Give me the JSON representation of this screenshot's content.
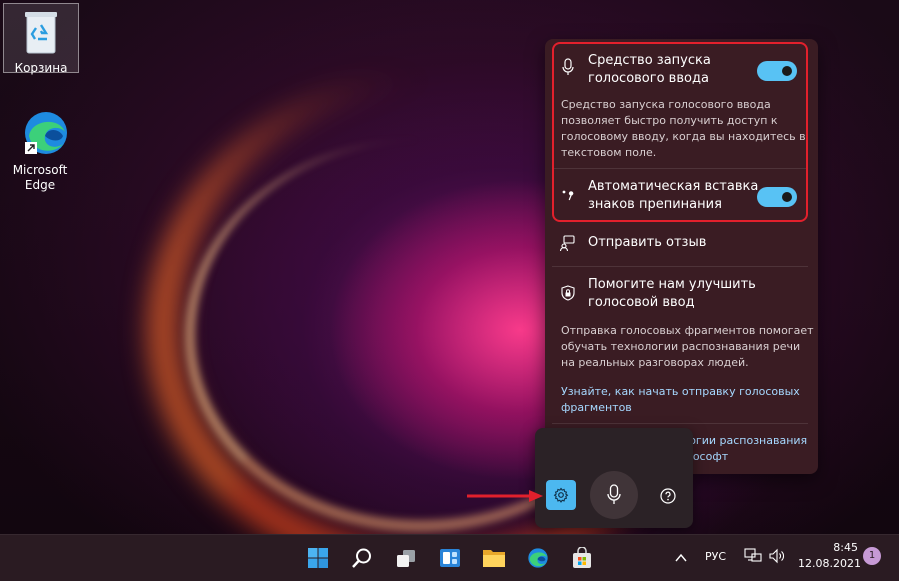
{
  "desktop": {
    "recycle_bin_label": "Корзина",
    "edge_label_line1": "Microsoft",
    "edge_label_line2": "Edge"
  },
  "flyout": {
    "launcher_title_line1": "Средство запуска",
    "launcher_title_line2": "голосового ввода",
    "launcher_toggle_on": true,
    "launcher_desc_line1": "Средство запуска голосового ввода",
    "launcher_desc_line2": "позволяет быстро получить доступ к",
    "launcher_desc_line3": "голосовому вводу, когда вы находитесь в",
    "launcher_desc_line4": "текстовом поле.",
    "punctuation_title_line1": "Автоматическая вставка",
    "punctuation_title_line2": "знаков препинания",
    "punctuation_toggle_on": true,
    "feedback_label": "Отправить отзыв",
    "improve_title_line1": "Помогите нам улучшить",
    "improve_title_line2": "голосовой ввод",
    "improve_desc_line1": "Отправка голосовых фрагментов помогает",
    "improve_desc_line2": "обучать технологии распознавания речи",
    "improve_desc_line3": "на реальных разговорах людей.",
    "learn_link_line1": "Узнайте, как начать отправку голосовых",
    "learn_link_line2": "фрагментов",
    "platform_link_line1": "На платформе технологии распознавания",
    "platform_link_line2": "речи по сети от Майкрософт"
  },
  "voicebar": {
    "settings_icon": "gear-icon",
    "mic_icon": "microphone-icon",
    "help_icon": "question-icon"
  },
  "taskbar": {
    "language": "РУС",
    "time": "8:45",
    "date": "12.08.2021",
    "notification_count": "1"
  },
  "colors": {
    "accent": "#58c2f4",
    "highlight_border": "#e1202c",
    "arrow": "#e1202c",
    "link": "#a6d8ff"
  }
}
